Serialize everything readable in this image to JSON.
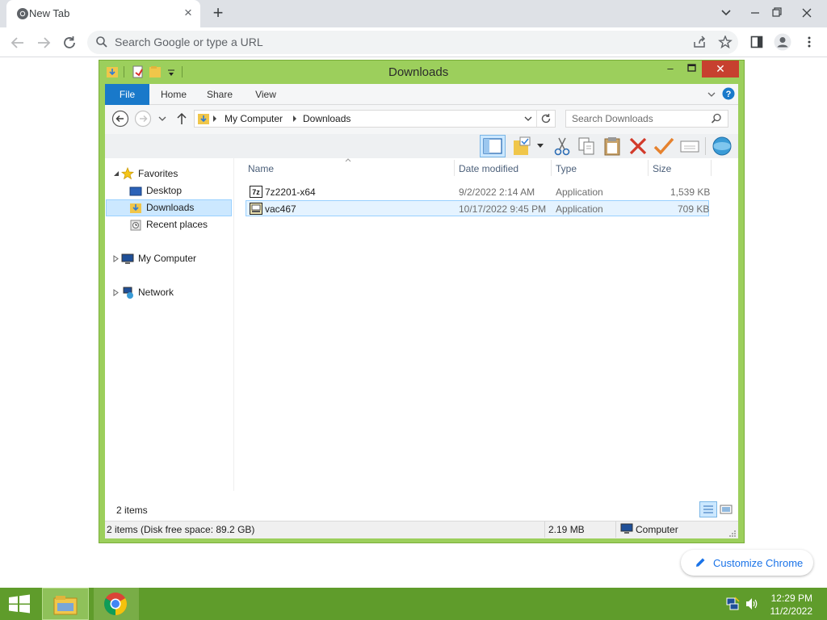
{
  "browser": {
    "tab_title": "New Tab",
    "omnibox_placeholder": "Search Google or type a URL",
    "customize_label": "Customize Chrome"
  },
  "explorer": {
    "window_title": "Downloads",
    "ribbon_tabs": [
      "File",
      "Home",
      "Share",
      "View"
    ],
    "breadcrumb": [
      "My Computer",
      "Downloads"
    ],
    "search_placeholder": "Search Downloads",
    "nav": {
      "favorites": "Favorites",
      "desktop": "Desktop",
      "downloads": "Downloads",
      "recent": "Recent places",
      "computer": "My Computer",
      "network": "Network"
    },
    "columns": [
      "Name",
      "Date modified",
      "Type",
      "Size"
    ],
    "files": [
      {
        "name": "7z2201-x64",
        "date": "9/2/2022 2:14 AM",
        "type": "Application",
        "size": "1,539 KB"
      },
      {
        "name": "vac467",
        "date": "10/17/2022 9:45 PM",
        "type": "Application",
        "size": "709 KB"
      }
    ],
    "item_count": "2 items",
    "status": {
      "summary": "2 items (Disk free space: 89.2 GB)",
      "size": "2.19 MB",
      "location": "Computer"
    }
  },
  "taskbar": {
    "time": "12:29 PM",
    "date": "11/2/2022"
  },
  "colors": {
    "window_frame": "#9ccf5c",
    "close_button": "#c7402f",
    "ribbon_file": "#1979ca",
    "taskbar": "#5f9c2b",
    "selection": "#cce8ff"
  }
}
